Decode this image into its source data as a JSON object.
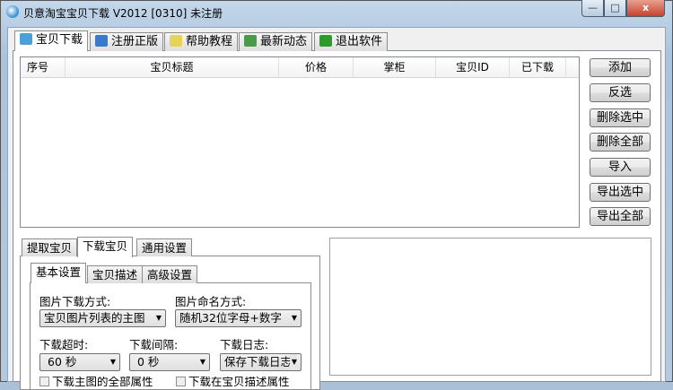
{
  "window": {
    "title": "贝意淘宝宝贝下载 V2012 [0310] 未注册",
    "minimize": "—",
    "maximize": "□",
    "close": "x"
  },
  "main_tabs": [
    {
      "label": "宝贝下载",
      "icon": "add-users-icon"
    },
    {
      "label": "注册正版",
      "icon": "register-icon"
    },
    {
      "label": "帮助教程",
      "icon": "help-bulb-icon"
    },
    {
      "label": "最新动态",
      "icon": "news-icon"
    },
    {
      "label": "退出软件",
      "icon": "exit-icon"
    }
  ],
  "list": {
    "columns": [
      "序号",
      "宝贝标题",
      "价格",
      "掌柜",
      "宝贝ID",
      "已下载"
    ],
    "rows": []
  },
  "buttons": [
    "添加",
    "反选",
    "删除选中",
    "删除全部",
    "导入",
    "导出选中",
    "导出全部"
  ],
  "lower_tabs": [
    "提取宝贝",
    "下载宝贝",
    "通用设置"
  ],
  "inner_tabs": [
    "基本设置",
    "宝贝描述",
    "高级设置"
  ],
  "settings": {
    "image_mode_label": "图片下载方式:",
    "image_mode_value": "宝贝图片列表的主图",
    "image_name_label": "图片命名方式:",
    "image_name_value": "随机32位字母+数字",
    "timeout_label": "下载超时:",
    "timeout_value": "60 秒",
    "interval_label": "下载间隔:",
    "interval_value": "0 秒",
    "log_label": "下载日志:",
    "log_value": "保存下载日志",
    "checkbox1": "下载主图的全部属性",
    "checkbox2": "下载在宝贝描述属性"
  }
}
